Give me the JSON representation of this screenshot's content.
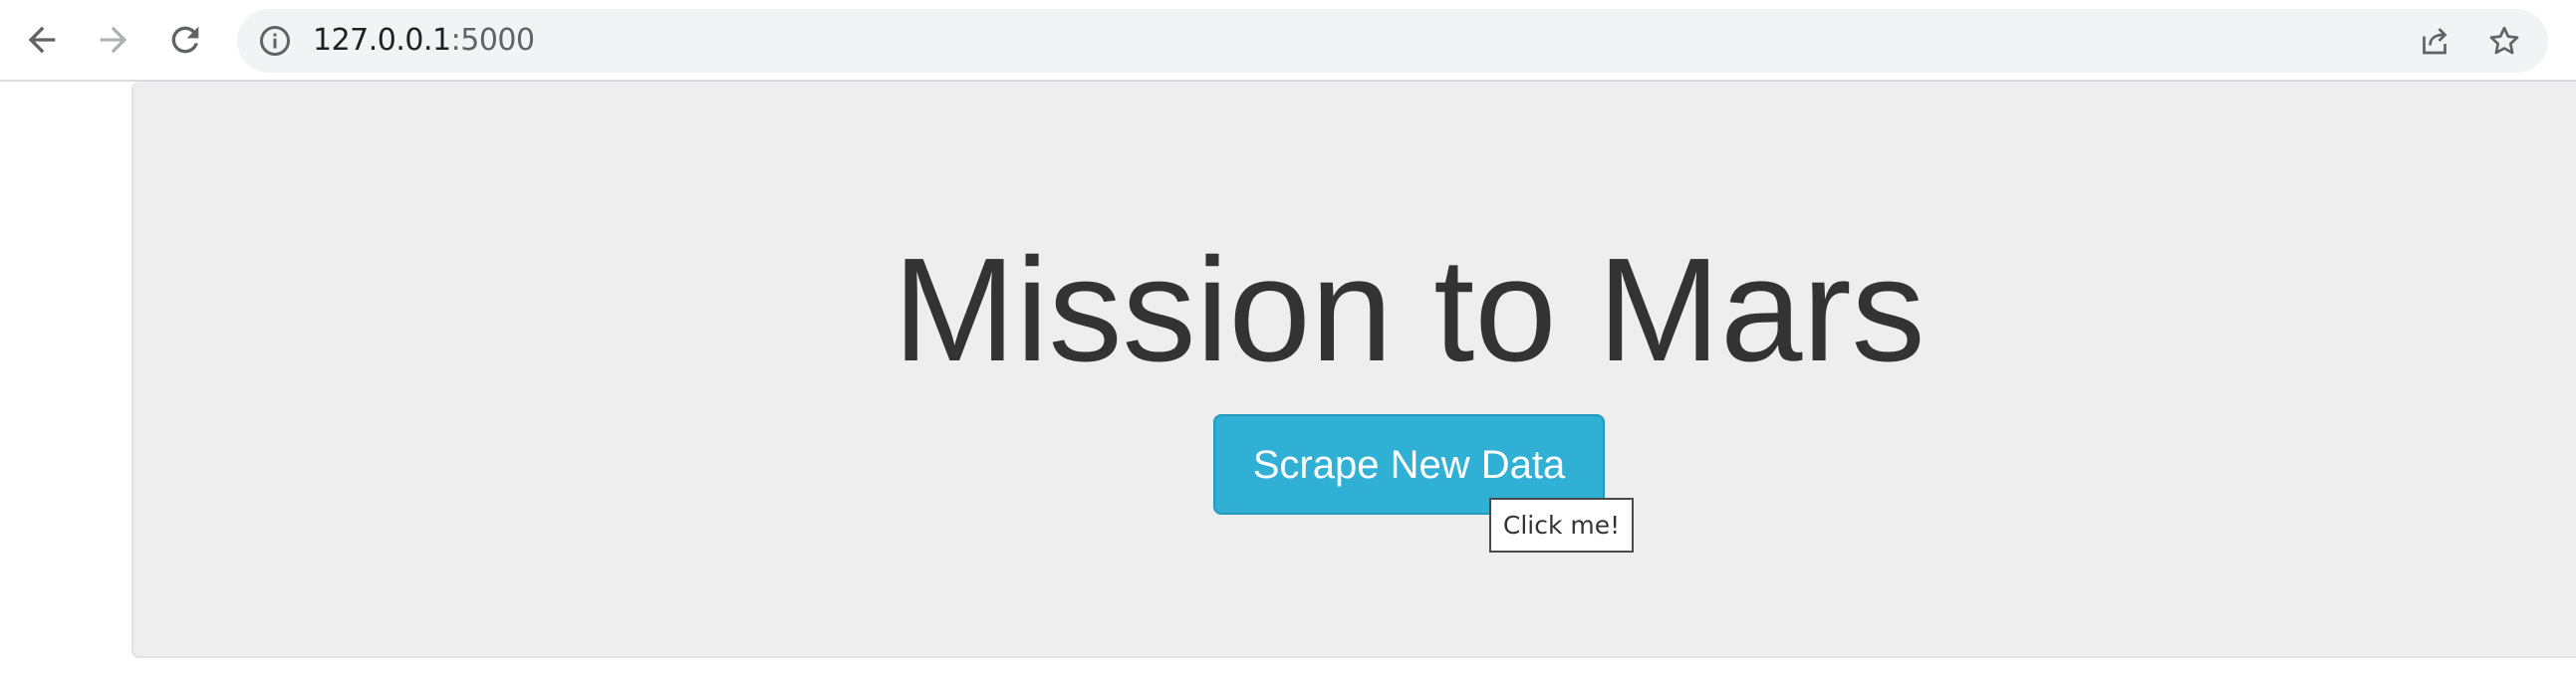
{
  "browser": {
    "url_host": "127.0.0.1",
    "url_port": ":5000",
    "icons": {
      "back": "back-arrow-icon",
      "forward": "forward-arrow-icon",
      "reload": "reload-icon",
      "info": "site-info-icon",
      "share": "share-icon",
      "bookmark": "star-icon"
    }
  },
  "page": {
    "title": "Mission to Mars",
    "scrape_button_label": "Scrape New Data",
    "tooltip": "Click me!"
  },
  "colors": {
    "button": "#31b0d5",
    "jumbotron": "#eeeeee",
    "title_text": "#333333"
  }
}
